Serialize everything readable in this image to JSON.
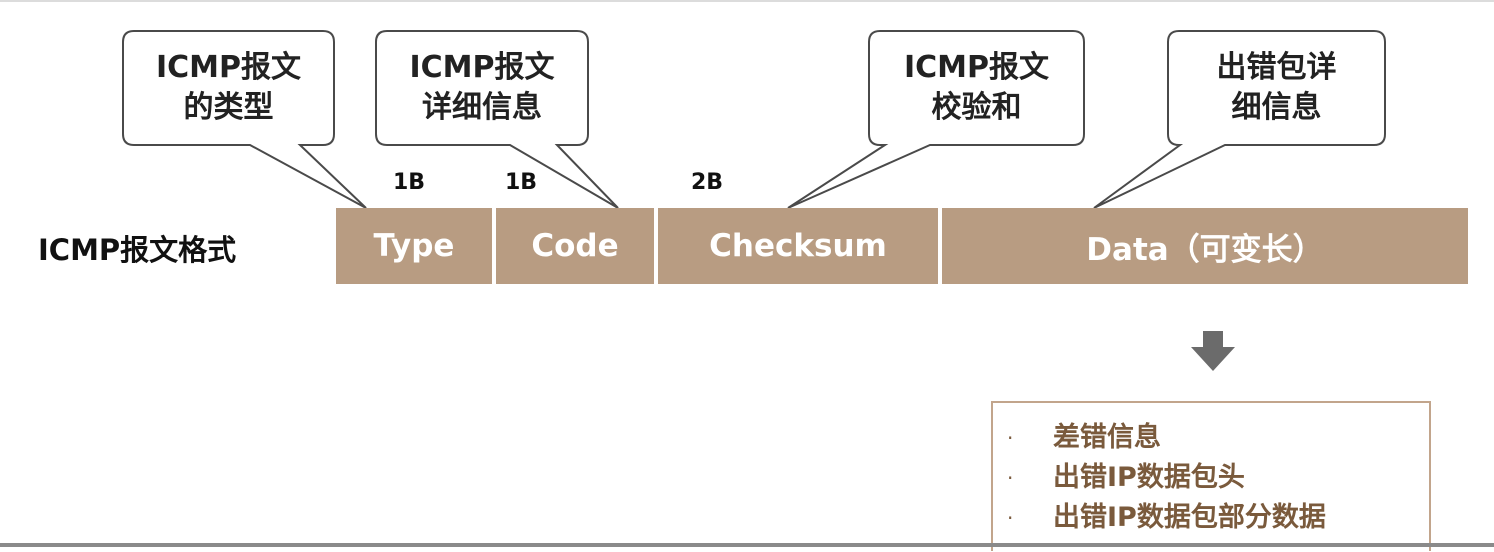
{
  "diagram": {
    "format_label": "ICMP报文格式",
    "fields": [
      {
        "id": "type",
        "label": "Type"
      },
      {
        "id": "code",
        "label": "Code"
      },
      {
        "id": "checksum",
        "label": "Checksum"
      },
      {
        "id": "data",
        "label": "Data（可变长）"
      }
    ],
    "sizes": [
      {
        "id": "type",
        "label": "1B"
      },
      {
        "id": "code",
        "label": "1B"
      },
      {
        "id": "checksum",
        "label": "2B"
      }
    ],
    "callouts": [
      {
        "id": "type",
        "lines": [
          "ICMP报文",
          "的类型"
        ]
      },
      {
        "id": "code",
        "lines": [
          "ICMP报文",
          "详细信息"
        ]
      },
      {
        "id": "checksum",
        "lines": [
          "ICMP报文",
          "校验和"
        ]
      },
      {
        "id": "data",
        "lines": [
          "出错包详",
          "细信息"
        ]
      }
    ],
    "data_details": {
      "bullet": "·",
      "items": [
        "差错信息",
        "出错IP数据包头",
        "出错IP数据包部分数据"
      ]
    },
    "colors": {
      "field_fill": "#b89c82",
      "callout_stroke": "#4a4a4a",
      "detail_text": "#7a5a3c",
      "arrow": "#6b6b6b"
    }
  }
}
